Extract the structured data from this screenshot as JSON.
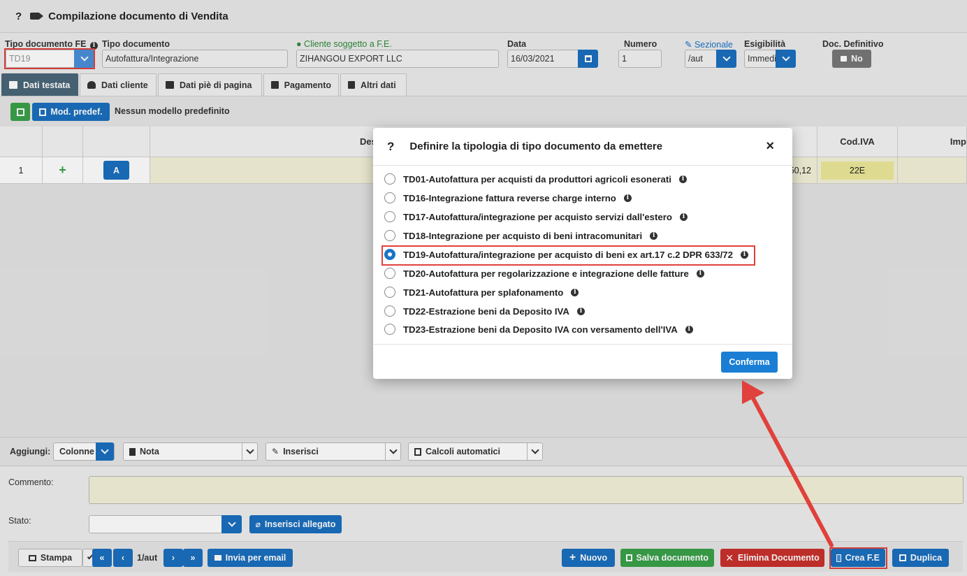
{
  "window": {
    "help_glyph": "?",
    "title": "Compilazione documento di Vendita"
  },
  "header": {
    "tipo_fe": {
      "label": "Tipo documento FE",
      "value": "TD19"
    },
    "tipo_doc": {
      "label": "Tipo documento",
      "value": "Autofattura/Integrazione"
    },
    "cliente": {
      "label": "Cliente soggetto a F.E.",
      "value": "ZIHANGOU EXPORT LLC"
    },
    "data": {
      "label": "Data",
      "value": "16/03/2021"
    },
    "numero": {
      "label": "Numero",
      "value": "1"
    },
    "sezionale": {
      "label": "Sezionale",
      "value": "/aut"
    },
    "esigibilita": {
      "label": "Esigibilità",
      "value": "Immediata"
    },
    "doc_definitivo": {
      "label": "Doc. Definitivo",
      "value": "No"
    }
  },
  "tabs": [
    {
      "label": "Dati testata",
      "active": true
    },
    {
      "label": "Dati cliente"
    },
    {
      "label": "Dati piè di pagina"
    },
    {
      "label": "Pagamento"
    },
    {
      "label": "Altri dati"
    }
  ],
  "toolbar": {
    "mod_predef_label": "Mod. predef.",
    "model_text": "Nessun modello predefinito"
  },
  "grid": {
    "headers": {
      "desc": "Des",
      "codiva": "Cod.IVA",
      "imp": "Imp"
    },
    "row": {
      "num": "1",
      "add": "+",
      "type": "A",
      "amount": "50,12",
      "codiva": "22E"
    }
  },
  "addbar": {
    "label": "Aggiungi:",
    "colonne": "Colonne",
    "nota": "Nota",
    "inserisci": "Inserisci",
    "calcoli": "Calcoli automatici"
  },
  "bottom": {
    "commento_label": "Commento:",
    "stato_label": "Stato:",
    "allegato_label": "Inserisci allegato",
    "stampa": "Stampa",
    "page": "1/aut",
    "invia": "Invia per email",
    "nuovo": "Nuovo",
    "salva": "Salva documento",
    "elimina": "Elimina Documento",
    "crea": "Crea F.E",
    "duplica": "Duplica"
  },
  "modal": {
    "title": "Definire la tipologia di tipo documento da emettere",
    "close": "×",
    "options": [
      "TD01-Autofattura per acquisti da produttori agricoli esonerati",
      "TD16-Integrazione fattura reverse charge interno",
      "TD17-Autofattura/integrazione per acquisto servizi dall'estero",
      "TD18-Integrazione per acquisto di beni intracomunitari",
      "TD19-Autofattura/integrazione per acquisto di beni ex art.17 c.2 DPR 633/72",
      "TD20-Autofattura per regolarizzazione e integrazione delle fatture",
      "TD21-Autofattura per splafonamento",
      "TD22-Estrazione beni da Deposito IVA",
      "TD23-Estrazione beni da Deposito IVA con versamento dell'IVA"
    ],
    "selected_index": 4,
    "confirm": "Conferma"
  },
  "colors": {
    "accent": "#1a6fbf",
    "highlight": "#e0413c",
    "tab_active": "#4a6779"
  }
}
